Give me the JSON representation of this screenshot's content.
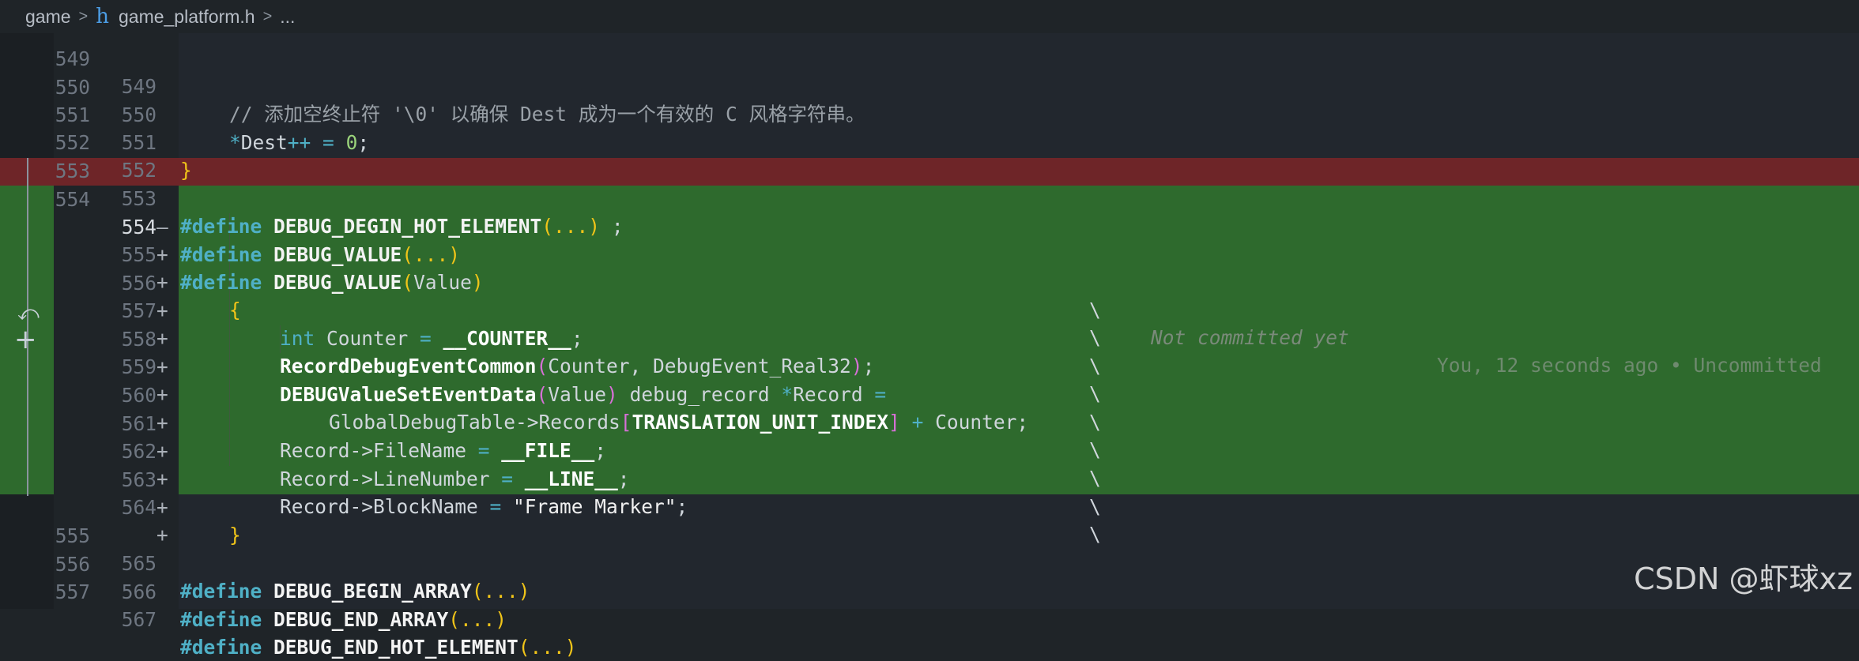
{
  "breadcrumb": {
    "folder": "game",
    "file_icon": "h",
    "file": "game_platform.h",
    "tail": "..."
  },
  "colors": {
    "deleted_bg": "#6e2528",
    "added_bg": "#2e6a2d",
    "keyword": "#4fb0c6",
    "paren": "#f0c419"
  },
  "lines": {
    "l0": {
      "ln1": "549",
      "ln2": "549",
      "text": "// 添加空终止符 '\\0' 以确保 Dest 成为一个有效的 C 风格字符串。"
    },
    "l1": {
      "ln1": "550",
      "ln2": "550",
      "star": "*",
      "ident": "Dest",
      "incr": "++",
      "eq": " = ",
      "num": "0",
      "semi": ";"
    },
    "l2": {
      "ln1": "551",
      "ln2": "551",
      "brace": "}"
    },
    "l3": {
      "ln1": "552",
      "ln2": "552"
    },
    "l4": {
      "ln1": "553",
      "ln2": "553",
      "kw": "#define",
      "name": "DEBUG_DEGIN_HOT_ELEMENT",
      "args": "(...)",
      "rest": " ;"
    },
    "l5": {
      "ln1": "554",
      "mark": "—",
      "kw": "#define",
      "name": "DEBUG_VALUE",
      "args": "(...)"
    },
    "l6": {
      "ln2": "554",
      "mark": "+",
      "kw": "#define",
      "name": "DEBUG_VALUE",
      "lp": "(",
      "arg": "Value",
      "rp": ")",
      "bs": "\\",
      "blame_msg": "Not committed yet",
      "blame_meta": "You, 12 seconds ago • Uncommitted"
    },
    "l7": {
      "ln2": "555",
      "mark": "+",
      "brace": "{",
      "bs": "\\"
    },
    "l8": {
      "ln2": "556",
      "mark": "+",
      "type": "int",
      "ident": " Counter ",
      "eq": "=",
      "mac": " __COUNTER__",
      "semi": ";",
      "bs": "\\"
    },
    "l9": {
      "ln2": "557",
      "mark": "+",
      "fn": "RecordDebugEventCommon",
      "lp": "(",
      "args": "Counter, DebugEvent_Real32",
      "rp": ")",
      "semi": ";",
      "bs": "\\"
    },
    "l10": {
      "ln2": "558",
      "mark": "+",
      "fn": "DEBUGValueSetEventData",
      "lp": "(",
      "arg": "Value",
      "rp": ")",
      "rest": " debug_record ",
      "star": "*",
      "rec": "Record ",
      "eq": "=",
      "bs": "\\"
    },
    "l11": {
      "ln2": "559",
      "mark": "+",
      "pre": "GlobalDebugTable->Records",
      "lb": "[",
      "idx": "TRANSLATION_UNIT_INDEX",
      "rb": "]",
      "plus": " + ",
      "post": "Counter;",
      "bs": "\\"
    },
    "l12": {
      "ln2": "560",
      "mark": "+",
      "pre": "Record->FileName ",
      "eq": "=",
      "mac": " __FILE__",
      "semi": ";",
      "bs": "\\"
    },
    "l13": {
      "ln2": "561",
      "mark": "+",
      "pre": "Record->LineNumber ",
      "eq": "=",
      "mac": " __LINE__",
      "semi": ";",
      "bs": "\\"
    },
    "l14": {
      "ln2": "562",
      "mark": "+",
      "pre": "Record->BlockName ",
      "eq": "=",
      "str": " \"Frame Marker\"",
      "semi": ";",
      "bs": "\\"
    },
    "l15": {
      "ln2": "563",
      "mark": "+",
      "brace": "}"
    },
    "l16": {
      "ln2": "564",
      "mark": "+"
    },
    "l17": {
      "ln1": "555",
      "ln2": "565",
      "kw": "#define",
      "name": "DEBUG_BEGIN_ARRAY",
      "args": "(...)"
    },
    "l18": {
      "ln1": "556",
      "ln2": "566",
      "kw": "#define",
      "name": "DEBUG_END_ARRAY",
      "args": "(...)"
    },
    "l19": {
      "ln1": "557",
      "ln2": "567",
      "kw": "#define",
      "name": "DEBUG_END_HOT_ELEMENT",
      "args": "(...)"
    }
  },
  "watermark": "CSDN @虾球xz",
  "icons": {
    "undo": "undo-icon",
    "add": "plus-icon"
  }
}
